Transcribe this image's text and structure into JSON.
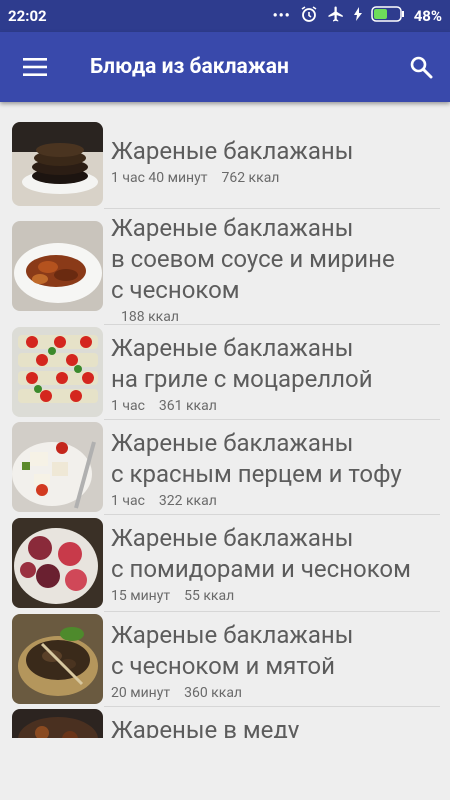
{
  "status": {
    "time": "22:02",
    "battery": "48%"
  },
  "toolbar": {
    "title": "Блюда из баклажан"
  },
  "recipes": [
    {
      "lines": [
        "Жареные баклажаны"
      ],
      "time": "1 час 40 минут",
      "kcal": "762 ккал"
    },
    {
      "lines": [
        "Жареные баклажаны",
        "в соевом соусе и мирине",
        "с чесноком"
      ],
      "time": "",
      "kcal": "188 ккал"
    },
    {
      "lines": [
        "Жареные баклажаны",
        "на гриле с моцареллой"
      ],
      "time": "1 час",
      "kcal": "361 ккал"
    },
    {
      "lines": [
        "Жареные баклажаны",
        "с красным перцем и тофу"
      ],
      "time": "1 час",
      "kcal": "322 ккал"
    },
    {
      "lines": [
        "Жареные баклажаны",
        "с помидорами и чесноком"
      ],
      "time": "15 минут",
      "kcal": "55 ккал"
    },
    {
      "lines": [
        "Жареные баклажаны",
        "с чесноком и мятой"
      ],
      "time": "20 минут",
      "kcal": "360 ккал"
    },
    {
      "lines": [
        "Жареные в меду"
      ],
      "time": "",
      "kcal": ""
    }
  ]
}
